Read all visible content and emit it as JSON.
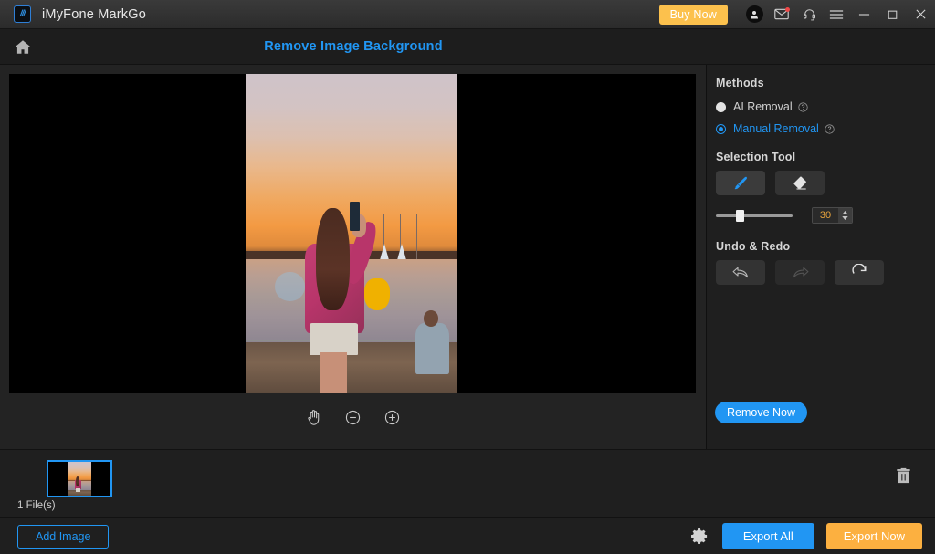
{
  "titlebar": {
    "app_title": "iMyFone MarkGo",
    "logo_icon": "markgo-logo-icon",
    "buy_now_label": "Buy Now",
    "icons": [
      {
        "name": "account-icon",
        "glyph": "user"
      },
      {
        "name": "mail-icon",
        "glyph": "envelope",
        "badge": true
      },
      {
        "name": "support-headset-icon",
        "glyph": "headset"
      },
      {
        "name": "menu-icon",
        "glyph": "hamburger"
      }
    ],
    "window_controls": [
      {
        "name": "minimize-button",
        "glyph": "minimize"
      },
      {
        "name": "maximize-button",
        "glyph": "maximize"
      },
      {
        "name": "close-button",
        "glyph": "close"
      }
    ]
  },
  "navbar": {
    "home_icon": "home-icon",
    "page_title": "Remove Image Background"
  },
  "canvas": {
    "zoom_tools": [
      {
        "name": "pan-hand-tool",
        "label": "hand-icon"
      },
      {
        "name": "zoom-out-button",
        "label": "minus-circle-icon"
      },
      {
        "name": "zoom-in-button",
        "label": "plus-circle-icon"
      }
    ]
  },
  "panel": {
    "methods_heading": "Methods",
    "methods": [
      {
        "label": "AI Removal",
        "selected": false,
        "help_icon": "help-circle-icon"
      },
      {
        "label": "Manual Removal",
        "selected": true,
        "help_icon": "help-circle-icon"
      }
    ],
    "selection_tool_heading": "Selection Tool",
    "tools": [
      {
        "name": "brush-tool",
        "icon": "brush-icon",
        "active": true
      },
      {
        "name": "eraser-tool",
        "icon": "eraser-icon",
        "active": false
      }
    ],
    "brush_size": "30",
    "undo_redo_heading": "Undo & Redo",
    "undo_redo": [
      {
        "name": "undo-button",
        "icon": "undo-arrow-icon",
        "enabled": true
      },
      {
        "name": "redo-button",
        "icon": "redo-arrow-icon",
        "enabled": false
      },
      {
        "name": "reset-button",
        "icon": "refresh-icon",
        "enabled": true
      }
    ],
    "remove_now_label": "Remove Now",
    "accent_blue": "#2196f3"
  },
  "filestrip": {
    "file_count": "1 File(s)",
    "trash_icon": "trash-icon",
    "thumbnail_selected": true
  },
  "bottombar": {
    "add_image_label": "Add Image",
    "settings_icon": "gear-icon",
    "export_all_label": "Export All",
    "export_now_label": "Export Now",
    "export_all_color": "#2196f3",
    "export_now_color": "#fcb040"
  }
}
